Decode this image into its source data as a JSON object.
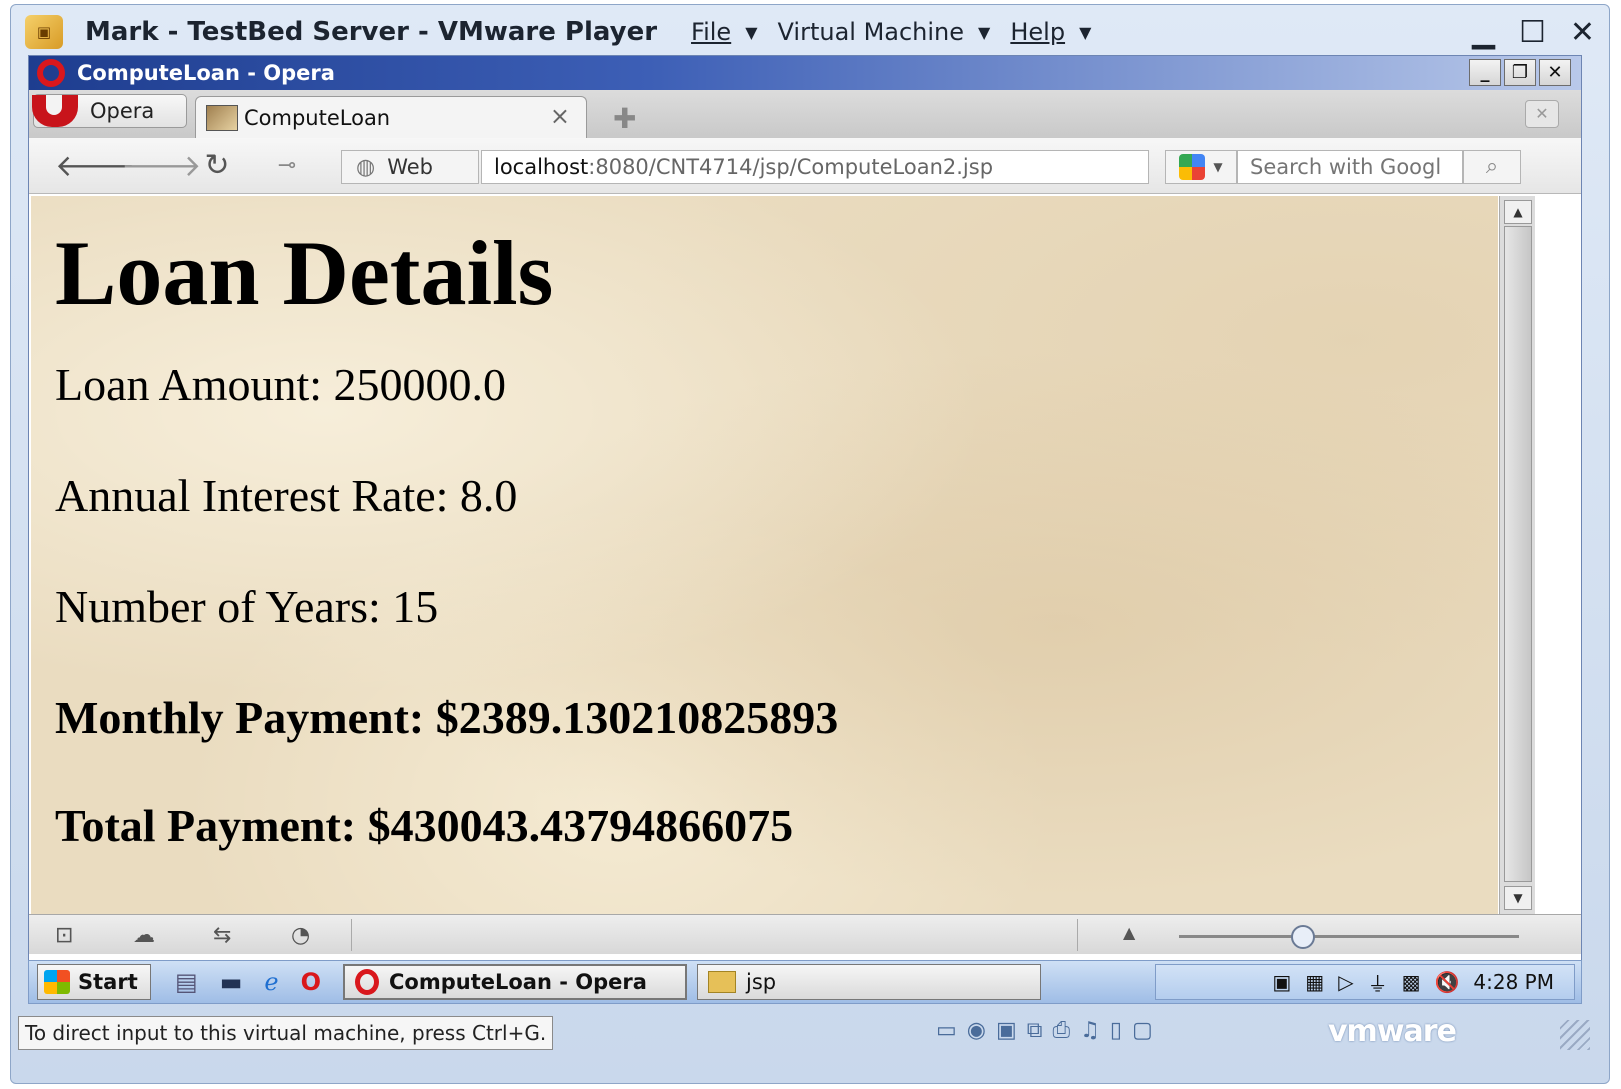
{
  "vmware": {
    "title": "Mark - TestBed Server - VMware Player",
    "menu": [
      {
        "label": "File"
      },
      {
        "label": "Virtual Machine"
      },
      {
        "label": "Help"
      }
    ],
    "hint": "To direct input to this virtual machine, press Ctrl+G.",
    "brand": "vmware"
  },
  "opera": {
    "window_title": "ComputeLoan - Opera",
    "menu_button_label": "Opera",
    "active_tab_label": "ComputeLoan",
    "web_button_label": "Web",
    "url_host": "localhost",
    "url_path": ":8080/CNT4714/jsp/ComputeLoan2.jsp",
    "search_placeholder": "Search with Googl"
  },
  "page": {
    "heading": "Loan Details",
    "loan_amount": "Loan Amount: 250000.0",
    "interest_rate": "Annual Interest Rate: 8.0",
    "years": "Number of Years: 15",
    "monthly_payment": "Monthly Payment: $2389.130210825893",
    "total_payment": "Total Payment: $430043.43794866075"
  },
  "taskbar": {
    "start_label": "Start",
    "tasks": [
      {
        "label": "ComputeLoan - Opera"
      },
      {
        "label": "jsp"
      }
    ],
    "clock": "4:28 PM"
  },
  "colors": {
    "page_background": "#eadcc0",
    "opera_red": "#d9171c",
    "opera_title_blue": "#1e3d8f"
  }
}
